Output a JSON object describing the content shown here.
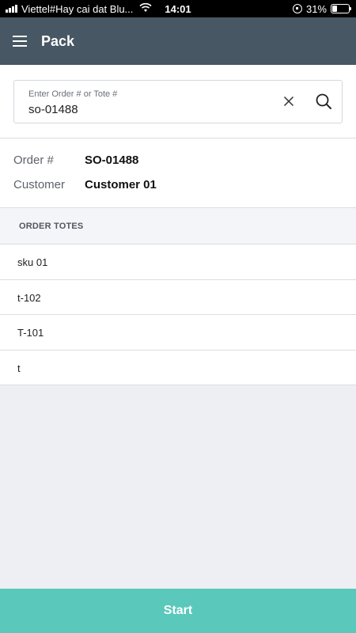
{
  "status_bar": {
    "carrier": "Viettel#Hay cai dat Blu...",
    "time": "14:01",
    "battery": "31%",
    "battery_level": 0.31,
    "icons": [
      "signal-icon",
      "wifi-icon",
      "rotation-lock-icon",
      "battery-icon"
    ]
  },
  "header": {
    "title": "Pack",
    "menu_icon": "hamburger-menu-icon"
  },
  "search": {
    "label": "Enter Order # or Tote #",
    "value": "so-01488",
    "clear_icon": "close-icon",
    "search_icon": "search-icon"
  },
  "order_info": {
    "order_label": "Order #",
    "order_value": "SO-01488",
    "customer_label": "Customer",
    "customer_value": "Customer 01"
  },
  "order_totes": {
    "title": "ORDER TOTES",
    "items": [
      "sku 01",
      "t-102",
      "T-101",
      "t"
    ]
  },
  "footer": {
    "start_label": "Start"
  },
  "colors": {
    "header_bg": "#475763",
    "start_bg": "#5ac8bb",
    "page_bg": "#eeeff3"
  }
}
